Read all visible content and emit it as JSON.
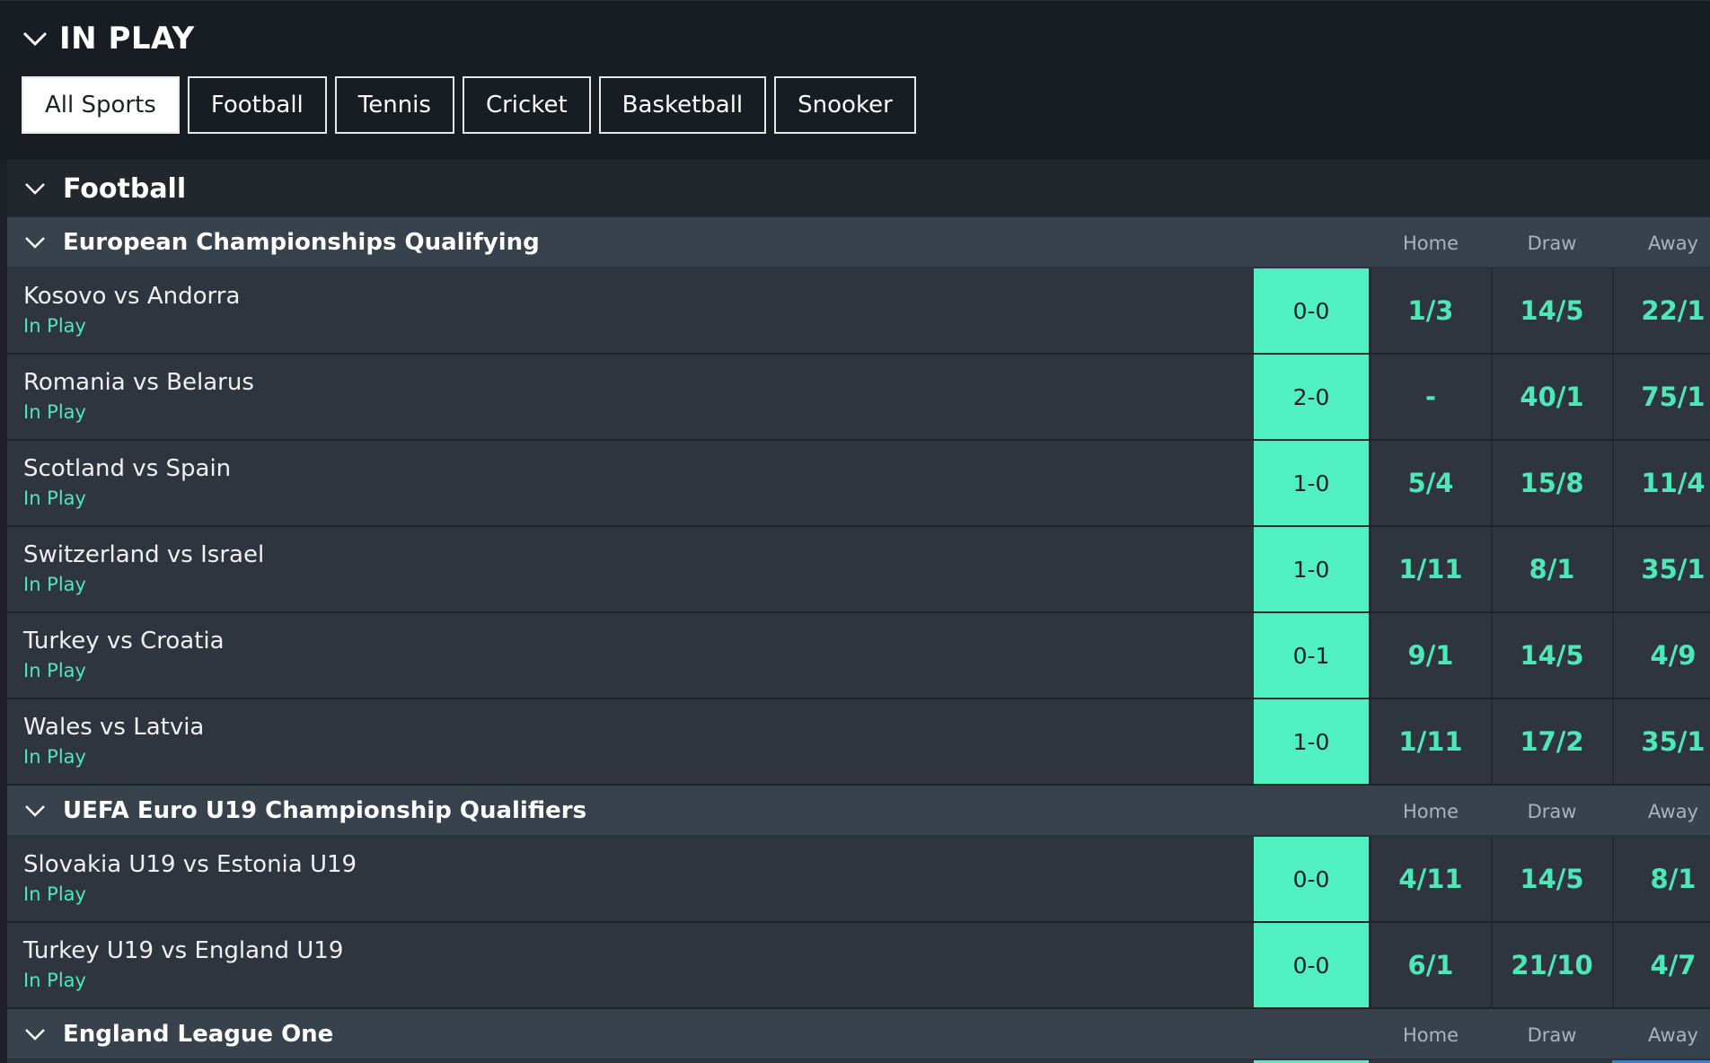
{
  "header": {
    "title": "IN PLAY"
  },
  "tabs": [
    {
      "label": "All Sports",
      "active": true
    },
    {
      "label": "Football",
      "active": false
    },
    {
      "label": "Tennis",
      "active": false
    },
    {
      "label": "Cricket",
      "active": false
    },
    {
      "label": "Basketball",
      "active": false
    },
    {
      "label": "Snooker",
      "active": false
    }
  ],
  "sport": {
    "title": "Football"
  },
  "columns": {
    "home": "Home",
    "draw": "Draw",
    "away": "Away"
  },
  "competitions": [
    {
      "title": "European Championships Qualifying",
      "matches": [
        {
          "name": "Kosovo vs Andorra",
          "status": "In Play",
          "score": "0-0",
          "home": "1/3",
          "draw": "14/5",
          "away": "22/1"
        },
        {
          "name": "Romania vs Belarus",
          "status": "In Play",
          "score": "2-0",
          "home": "-",
          "draw": "40/1",
          "away": "75/1"
        },
        {
          "name": "Scotland vs Spain",
          "status": "In Play",
          "score": "1-0",
          "home": "5/4",
          "draw": "15/8",
          "away": "11/4"
        },
        {
          "name": "Switzerland vs Israel",
          "status": "In Play",
          "score": "1-0",
          "home": "1/11",
          "draw": "8/1",
          "away": "35/1"
        },
        {
          "name": "Turkey vs Croatia",
          "status": "In Play",
          "score": "0-1",
          "home": "9/1",
          "draw": "14/5",
          "away": "4/9"
        },
        {
          "name": "Wales vs Latvia",
          "status": "In Play",
          "score": "1-0",
          "home": "1/11",
          "draw": "17/2",
          "away": "35/1"
        }
      ]
    },
    {
      "title": "UEFA Euro U19 Championship Qualifiers",
      "matches": [
        {
          "name": "Slovakia U19 vs Estonia U19",
          "status": "In Play",
          "score": "0-0",
          "home": "4/11",
          "draw": "14/5",
          "away": "8/1"
        },
        {
          "name": "Turkey U19 vs England U19",
          "status": "In Play",
          "score": "0-0",
          "home": "6/1",
          "draw": "21/10",
          "away": "4/7"
        }
      ]
    },
    {
      "title": "England League One",
      "matches": []
    }
  ],
  "colors": {
    "accent": "#4ee8b8",
    "score_bg": "#50f0c0",
    "background": "#1d2127"
  }
}
